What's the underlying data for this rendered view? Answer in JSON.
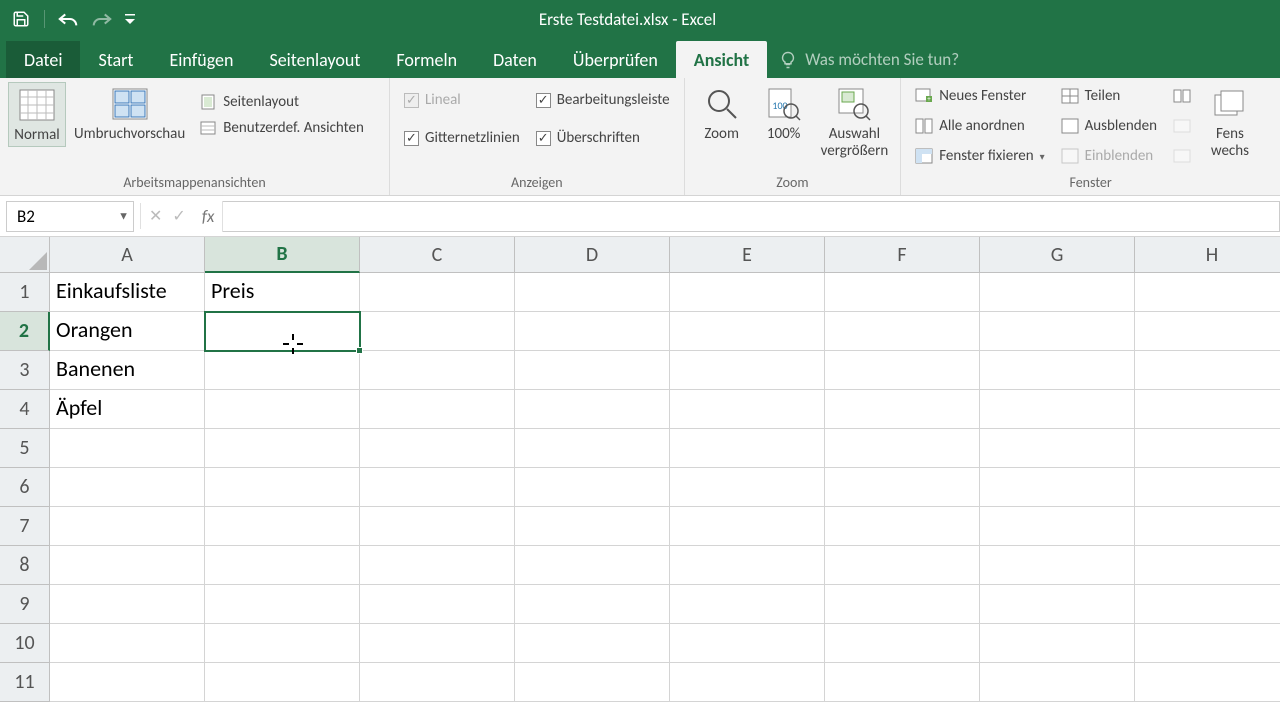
{
  "title": "Erste Testdatei.xlsx - Excel",
  "tabs": {
    "file": "Datei",
    "home": "Start",
    "insert": "Einfügen",
    "pagelayout": "Seitenlayout",
    "formulas": "Formeln",
    "data": "Daten",
    "review": "Überprüfen",
    "view": "Ansicht",
    "tellme": "Was möchten Sie tun?"
  },
  "ribbon": {
    "groups": {
      "views": {
        "label": "Arbeitsmappenansichten",
        "normal": "Normal",
        "pagebreak": "Umbruchvorschau",
        "pagelayout": "Seitenlayout",
        "custom": "Benutzerdef. Ansichten"
      },
      "show": {
        "label": "Anzeigen",
        "ruler": "Lineal",
        "gridlines": "Gitternetzlinien",
        "formulabar": "Bearbeitungsleiste",
        "headings": "Überschriften"
      },
      "zoom": {
        "label": "Zoom",
        "zoom": "Zoom",
        "hundred": "100%",
        "selection_l1": "Auswahl",
        "selection_l2": "vergrößern"
      },
      "window": {
        "label": "Fenster",
        "new": "Neues Fenster",
        "arrange": "Alle anordnen",
        "freeze": "Fenster fixieren",
        "split": "Teilen",
        "hide": "Ausblenden",
        "unhide": "Einblenden",
        "switch_l1": "Fens",
        "switch_l2": "wechs"
      }
    }
  },
  "nameBox": "B2",
  "formula": "",
  "columns": [
    "A",
    "B",
    "C",
    "D",
    "E",
    "F",
    "G",
    "H"
  ],
  "selectedCol": "B",
  "selectedRow": 2,
  "rowCount": 11,
  "cells": {
    "A1": "Einkaufsliste",
    "B1": "Preis",
    "A2": "Orangen",
    "A3": "Banenen",
    "A4": "Äpfel"
  }
}
